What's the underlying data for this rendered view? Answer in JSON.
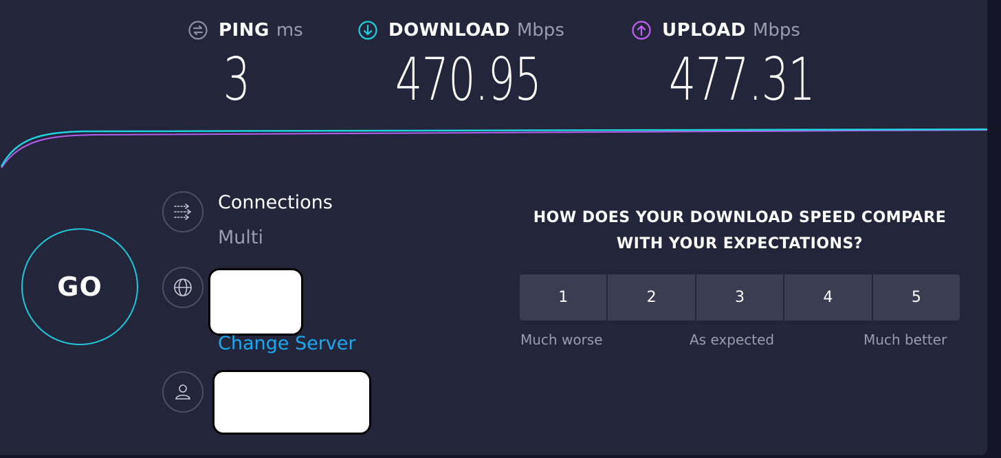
{
  "metrics": {
    "ping": {
      "label": "PING",
      "unit": "ms",
      "value": "3",
      "color": "#8e90a6"
    },
    "download": {
      "label": "DOWNLOAD",
      "unit": "Mbps",
      "value": "470.95",
      "color": "#1ed2de"
    },
    "upload": {
      "label": "UPLOAD",
      "unit": "Mbps",
      "value": "477.31",
      "color": "#c361f5"
    }
  },
  "go_button": {
    "label": "GO"
  },
  "connections": {
    "label": "Connections",
    "value": "Multi"
  },
  "server": {
    "change_label": "Change Server"
  },
  "survey": {
    "title_line1": "HOW DOES YOUR DOWNLOAD SPEED COMPARE",
    "title_line2": "WITH YOUR EXPECTATIONS?",
    "ratings": [
      "1",
      "2",
      "3",
      "4",
      "5"
    ],
    "scale_low": "Much worse",
    "scale_mid": "As expected",
    "scale_high": "Much better"
  },
  "colors": {
    "accent": "#1ec6d8",
    "link": "#1aa8f0",
    "panel": "#23253b"
  }
}
